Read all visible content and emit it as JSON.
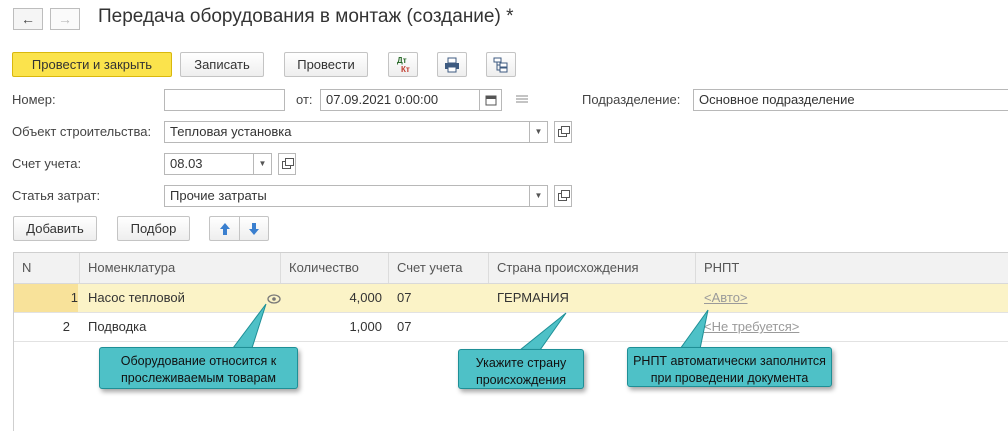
{
  "window": {
    "title": "Передача оборудования в монтаж (создание) *",
    "back_glyph": "←",
    "forward_glyph": "→"
  },
  "toolbar": {
    "post_close": "Провести и закрыть",
    "save": "Записать",
    "post": "Провести",
    "dtkt_top": "Дт",
    "dtkt_bottom": "Кт",
    "icons": [
      "dt-kt-icon",
      "print-icon",
      "structure-icon"
    ]
  },
  "form": {
    "number_label": "Номер:",
    "number_value": "",
    "date_label": "от:",
    "date_value": "07.09.2021  0:00:00",
    "subdivision_label": "Подразделение:",
    "subdivision_value": "Основное подразделение",
    "object_label": "Объект строительства:",
    "object_value": "Тепловая установка",
    "account_label": "Счет учета:",
    "account_value": "08.03",
    "cost_label": "Статья затрат:",
    "cost_value": "Прочие затраты"
  },
  "table_toolbar": {
    "add": "Добавить",
    "pick": "Подбор"
  },
  "table": {
    "headers": [
      "N",
      "Номенклатура",
      "Количество",
      "Счет учета",
      "Страна происхождения",
      "РНПТ"
    ],
    "rows": [
      {
        "n": "1",
        "item": "Насос тепловой",
        "qty": "4,000",
        "account": "07",
        "country": "ГЕРМАНИЯ",
        "rnpt": "<Авто>"
      },
      {
        "n": "2",
        "item": "Подводка",
        "qty": "1,000",
        "account": "07",
        "country": "",
        "rnpt": "<Не требуется>"
      }
    ]
  },
  "callouts": {
    "tracked_line1": "Оборудование относится к",
    "tracked_line2": "прослеживаемым товарам",
    "country_line1": "Укажите страну",
    "country_line2": "происхождения",
    "rnpt_line1": "РНПТ автоматически заполнится",
    "rnpt_line2": "при проведении документа"
  },
  "colors": {
    "primary_button": "#fbe34c",
    "selected_row": "#fbf3c7",
    "callout": "#4ec1c7",
    "arrow_buttons": "#3a7fcf"
  }
}
